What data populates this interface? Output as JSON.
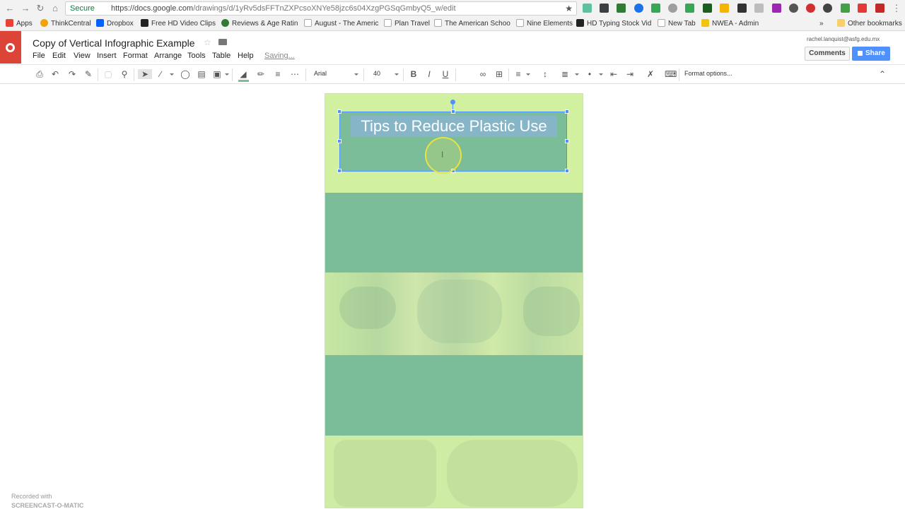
{
  "browser": {
    "secure_label": "Secure",
    "url_host": "https://docs.google.com",
    "url_path": "/drawings/d/1yRv5dsFFTnZXPcsoXNYe58jzc6s04XzgPGSqGmbyQ5_w/edit",
    "bookmarks": [
      {
        "label": "Apps",
        "color": "#ea4335"
      },
      {
        "label": "ThinkCentral",
        "color": "#f4a300"
      },
      {
        "label": "Dropbox",
        "color": "#0061fe"
      },
      {
        "label": "Free HD Video Clips",
        "color": "#222222"
      },
      {
        "label": "Reviews & Age Ratin",
        "color": "#2e7d32"
      },
      {
        "label": "August - The Americ",
        "color": "#ffffff"
      },
      {
        "label": "Plan Travel",
        "color": "#ffffff"
      },
      {
        "label": "The American Schoo",
        "color": "#ffffff"
      },
      {
        "label": "Nine Elements",
        "color": "#ffffff"
      },
      {
        "label": "HD Typing Stock Vid",
        "color": "#222222"
      },
      {
        "label": "New Tab",
        "color": "#ffffff"
      },
      {
        "label": "NWEA - Admin",
        "color": "#f1c40f"
      }
    ],
    "other_bookmarks": "Other bookmarks",
    "overflow": "»"
  },
  "doc": {
    "title": "Copy of Vertical Infographic Example",
    "saving_status": "Saving...",
    "account": "rachel.lanquist@asfg.edu.mx",
    "comments_label": "Comments",
    "share_label": "Share",
    "menus": [
      "File",
      "Edit",
      "View",
      "Insert",
      "Format",
      "Arrange",
      "Tools",
      "Table",
      "Help"
    ]
  },
  "toolbar": {
    "font_name": "Arial",
    "font_size": "40",
    "format_options": "Format options..."
  },
  "canvas": {
    "title_text": "Tips to Reduce Plastic Use"
  },
  "overlay": {
    "recorded_with": "Recorded with",
    "recorder_name": "SCREENCAST-O-MATIC"
  },
  "colors": {
    "page_bg": "#d1f0a0",
    "band_green": "#7bbd98",
    "selection": "#4d90fe",
    "docs_red": "#db4437"
  }
}
